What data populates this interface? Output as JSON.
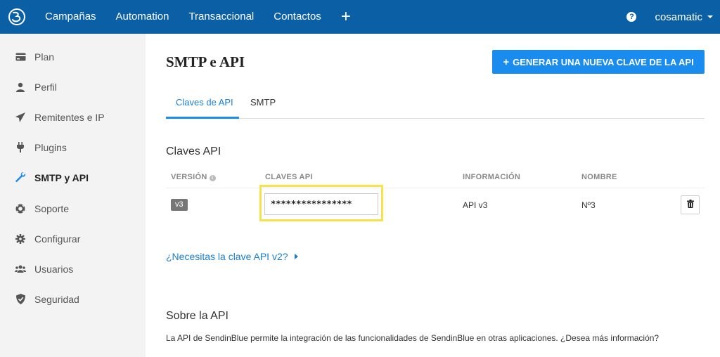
{
  "nav": {
    "items": [
      "Campañas",
      "Automation",
      "Transaccional",
      "Contactos"
    ],
    "plus": "+",
    "help": "?",
    "user": "cosamatic"
  },
  "sidebar": {
    "items": [
      {
        "label": "Plan",
        "icon": "card-icon"
      },
      {
        "label": "Perfil",
        "icon": "user-icon"
      },
      {
        "label": "Remitentes e IP",
        "icon": "paper-plane-icon"
      },
      {
        "label": "Plugins",
        "icon": "plug-icon"
      },
      {
        "label": "SMTP y API",
        "icon": "wrench-icon",
        "active": true
      },
      {
        "label": "Soporte",
        "icon": "life-ring-icon"
      },
      {
        "label": "Configurar",
        "icon": "gear-icon"
      },
      {
        "label": "Usuarios",
        "icon": "users-icon"
      },
      {
        "label": "Seguridad",
        "icon": "shield-icon"
      }
    ]
  },
  "main": {
    "title": "SMTP e API",
    "generate_button": "GENERAR UNA NUEVA CLAVE DE LA API",
    "tabs": [
      {
        "label": "Claves de API",
        "active": true
      },
      {
        "label": "SMTP",
        "active": false
      }
    ],
    "keys_section_title": "Claves API",
    "table": {
      "headers": [
        "VERSIÓN",
        "CLAVES API",
        "INFORMACIÓN",
        "NOMBRE"
      ],
      "rows": [
        {
          "version": "v3",
          "key": "****************",
          "info": "API v3",
          "name": "Nº3"
        }
      ]
    },
    "v2_link": "¿Necesitas la clave API v2?",
    "about_title": "Sobre la API",
    "about_text": "La API de SendinBlue permite la integración de las funcionalidades de SendinBlue en otras aplicaciones. ¿Desea más información?"
  },
  "colors": {
    "topbar": "#0b5fa5",
    "accent": "#1a8cf0",
    "highlight": "#f7e24b",
    "sidebar_bg": "#f3f3f3"
  }
}
